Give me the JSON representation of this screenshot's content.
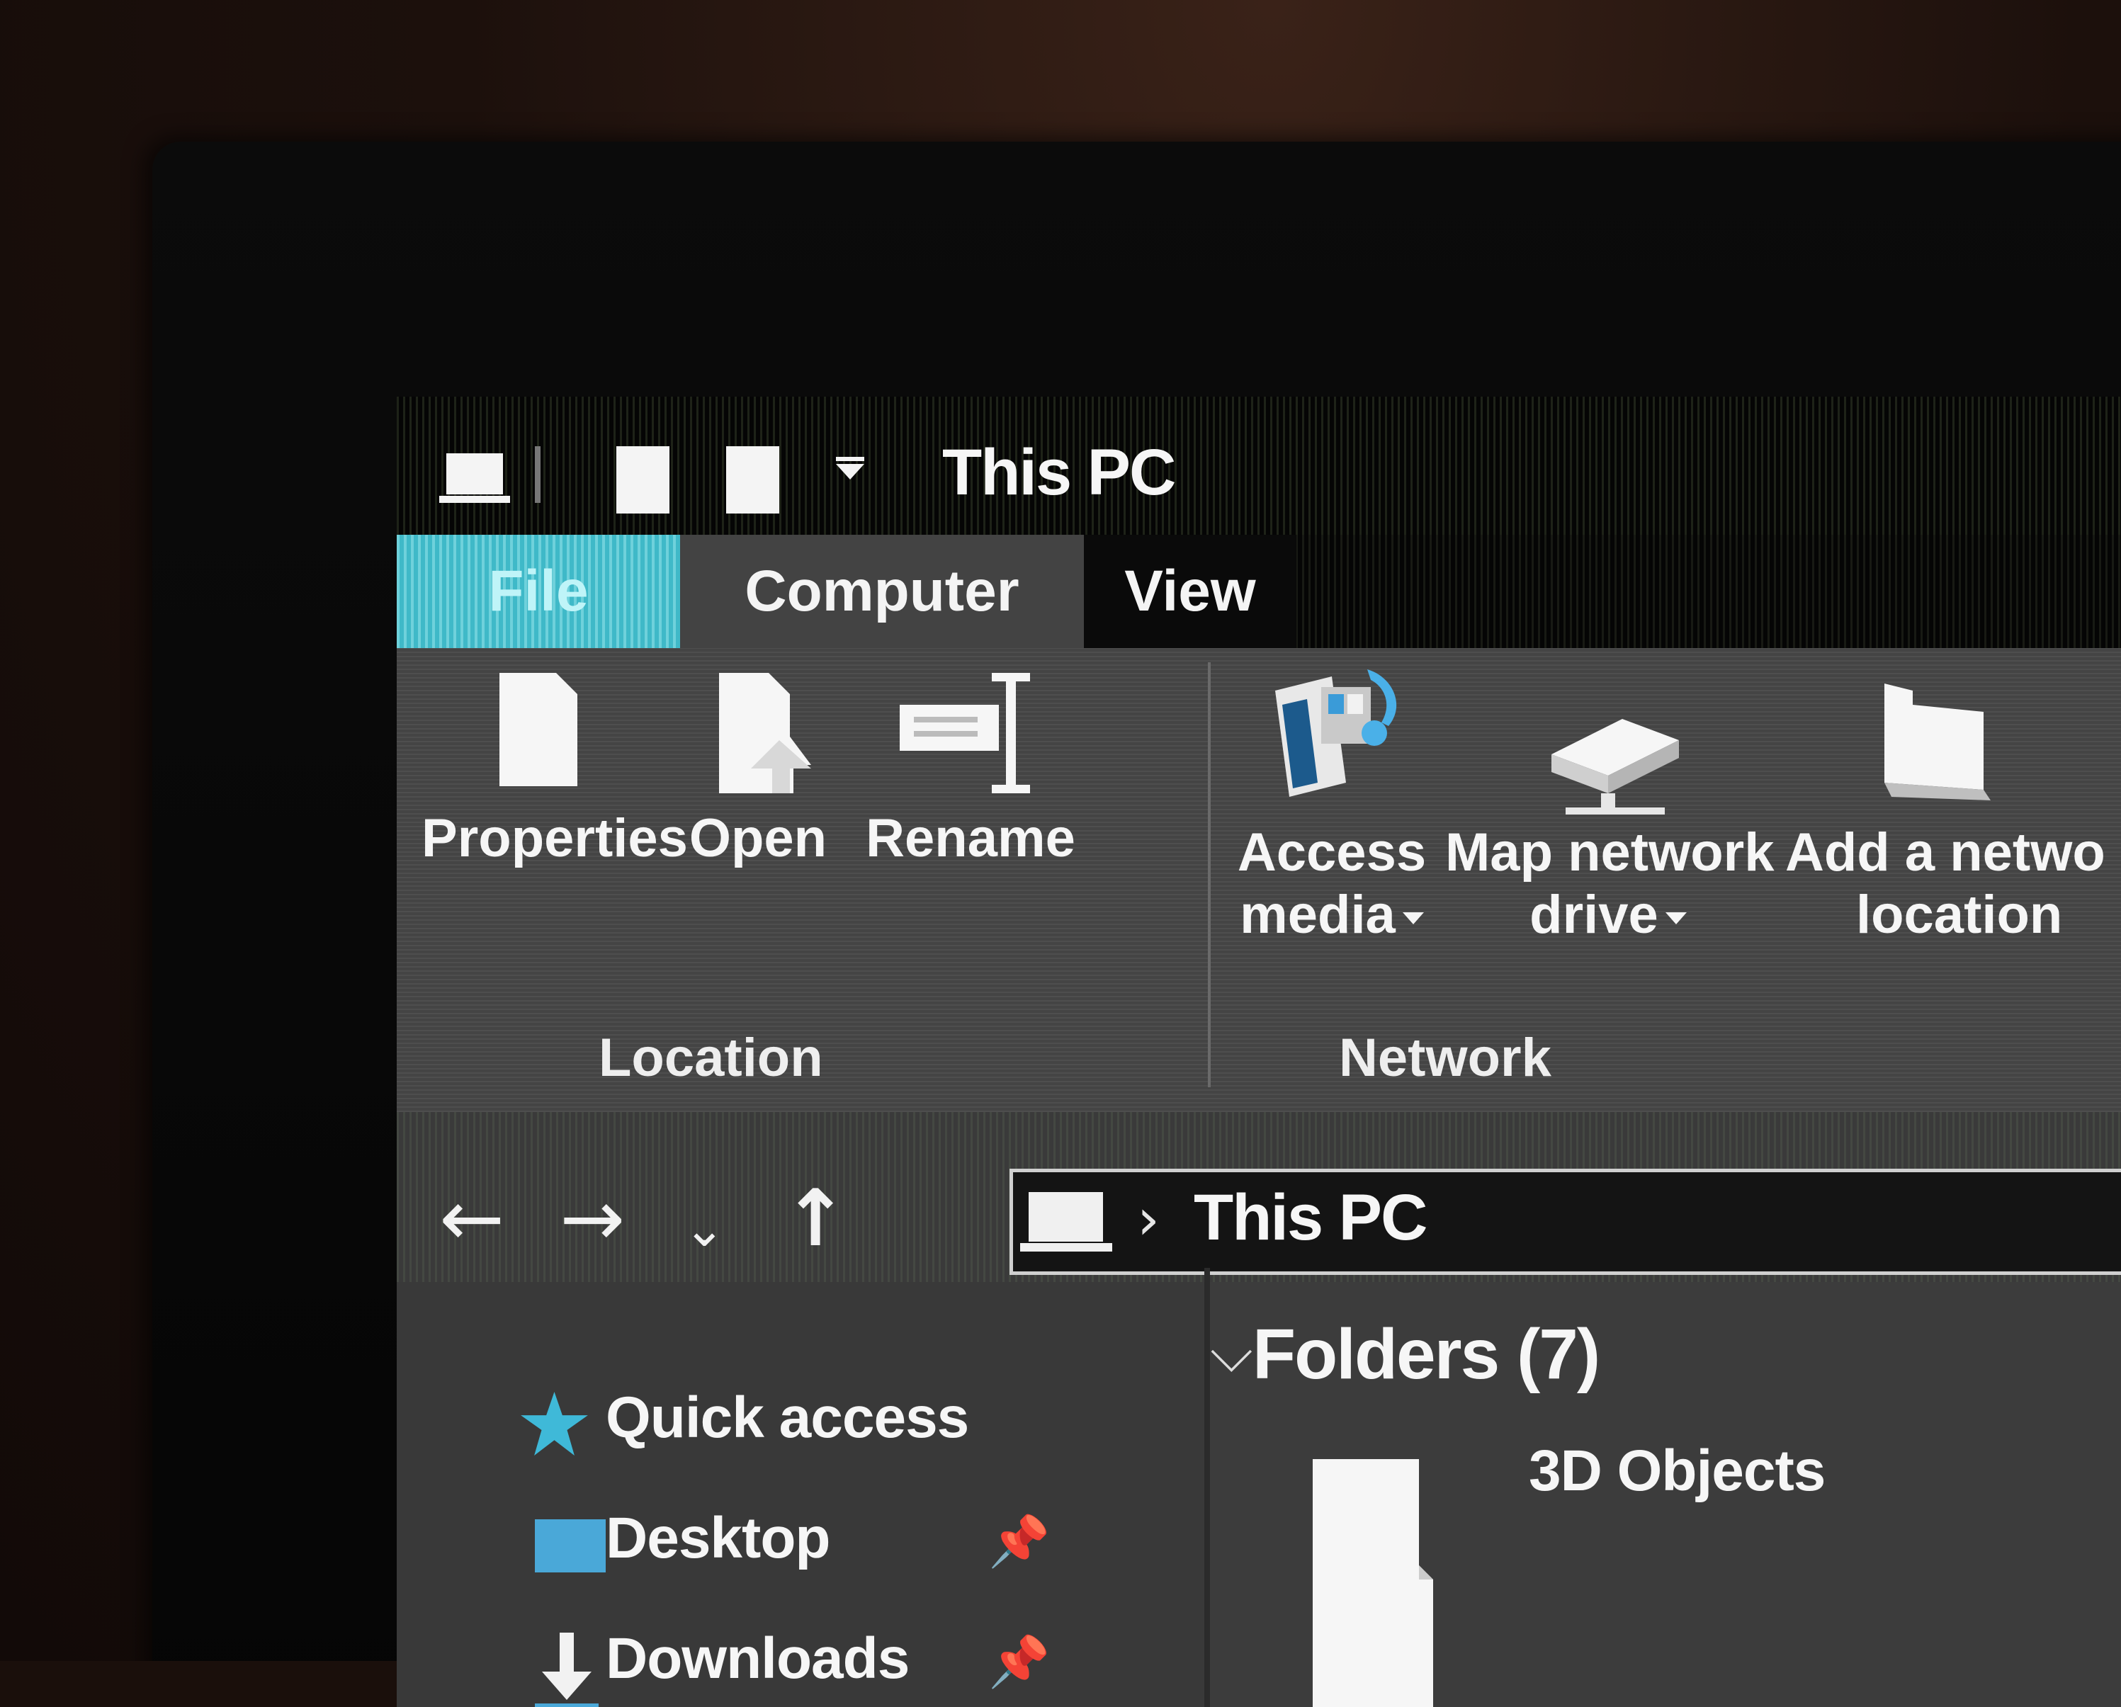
{
  "window": {
    "title": "This PC"
  },
  "ribbon": {
    "tabs": [
      {
        "label": "File"
      },
      {
        "label": "Computer"
      },
      {
        "label": "View"
      }
    ],
    "groups": [
      {
        "label": "Location",
        "buttons": [
          {
            "label": "Properties",
            "icon": "properties-icon"
          },
          {
            "label": "Open",
            "icon": "open-icon"
          },
          {
            "label": "Rename",
            "icon": "rename-icon"
          }
        ]
      },
      {
        "label": "Network",
        "buttons": [
          {
            "label_line1": "Access",
            "label_line2": "media",
            "icon": "access-media-icon",
            "has_dropdown": true
          },
          {
            "label_line1": "Map network",
            "label_line2": "drive",
            "icon": "map-network-drive-icon",
            "has_dropdown": true
          },
          {
            "label_line1": "Add a netwo",
            "label_line2": "location",
            "icon": "add-network-location-icon"
          }
        ]
      }
    ]
  },
  "navigation": {
    "back": "←",
    "forward": "→",
    "recent": "⌄",
    "up": "↑",
    "address": {
      "separator": "›",
      "location": "This PC"
    }
  },
  "nav_pane": {
    "items": [
      {
        "label": "Quick access",
        "icon": "star-icon"
      },
      {
        "label": "Desktop",
        "icon": "desktop-icon",
        "pinned": true
      },
      {
        "label": "Downloads",
        "icon": "downloads-icon",
        "pinned": true
      }
    ],
    "pin_glyph": "📌"
  },
  "content": {
    "section_title": "Folders (7)",
    "section_chevron": "⌵",
    "items": [
      {
        "label": "3D Objects",
        "icon": "folder-icon"
      }
    ]
  },
  "colors": {
    "accent": "#3fb9c8",
    "ribbon_bg": "#444444",
    "titlebar_bg": "#050505",
    "text": "#f6f6f6"
  }
}
